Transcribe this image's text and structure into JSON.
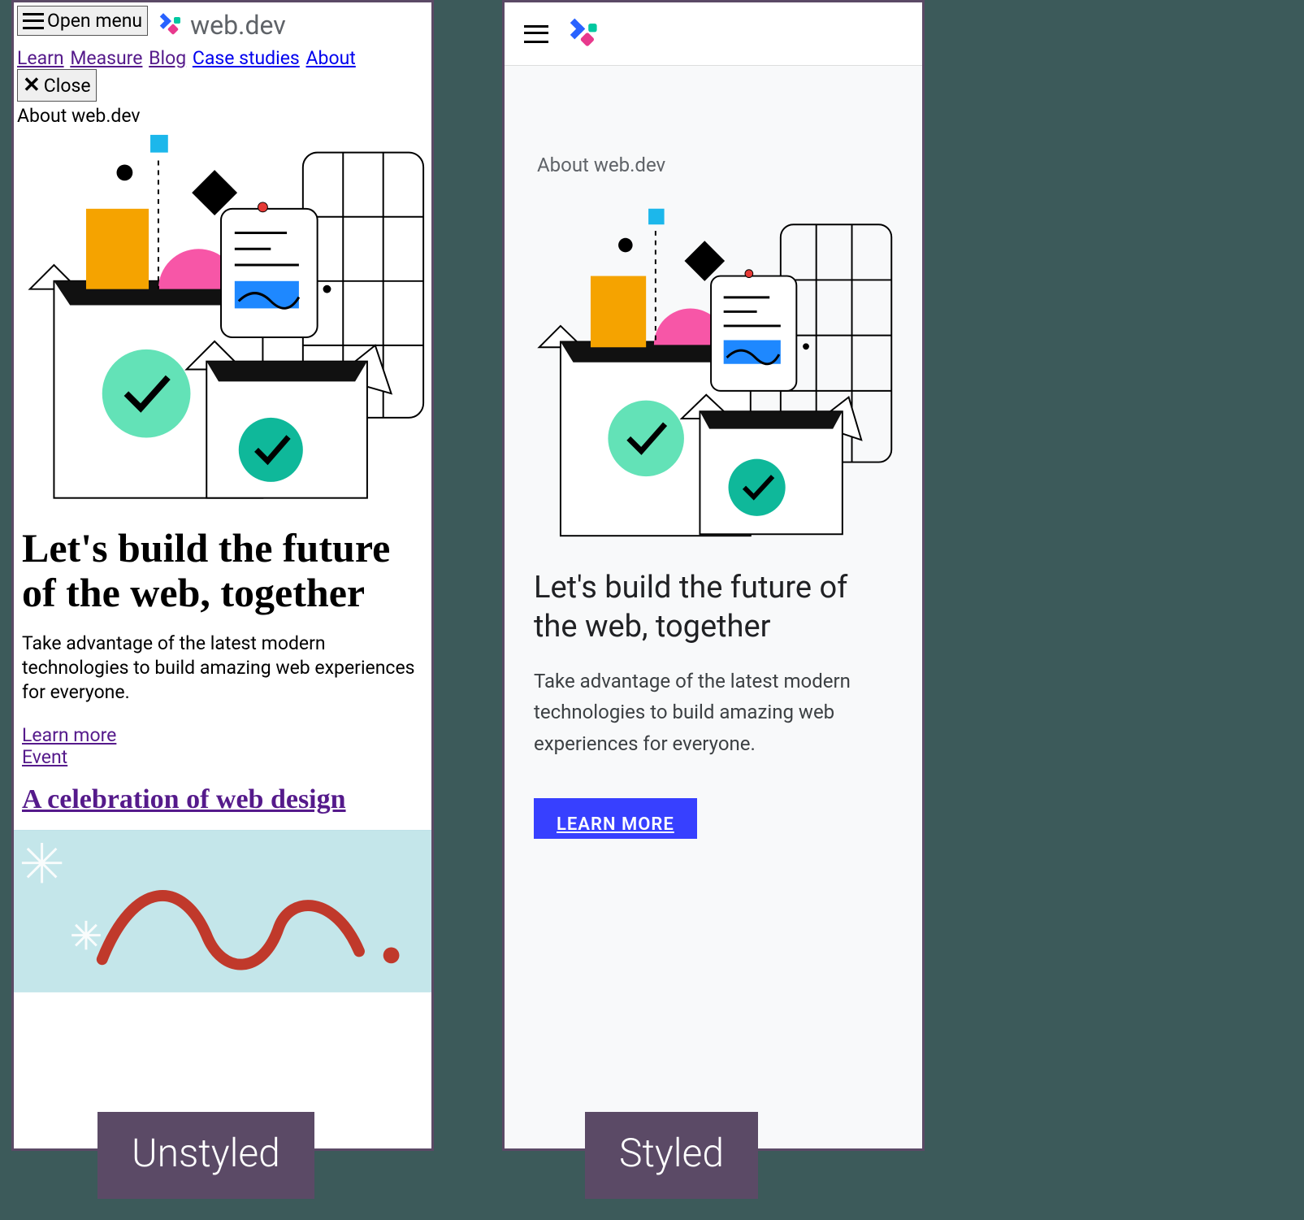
{
  "captions": {
    "unstyled": "Unstyled",
    "styled": "Styled"
  },
  "brand": {
    "name": "web.dev"
  },
  "unstyled": {
    "open_menu": "Open menu",
    "close": "Close",
    "nav": {
      "learn": "Learn",
      "measure": "Measure",
      "blog": "Blog",
      "case_studies": "Case studies",
      "about": "About"
    },
    "eyebrow": "About web.dev",
    "heading": "Let's build the future of the web, together",
    "sub": "Take advantage of the latest modern technologies to build amazing web experiences for everyone.",
    "learn_more": "Learn more",
    "event": "Event",
    "article_title": "A celebration of web design"
  },
  "styled": {
    "eyebrow": "About web.dev",
    "heading": "Let's build the future of the web, together",
    "sub": "Take advantage of the latest modern technologies to build amazing web experiences for everyone.",
    "cta": "LEARN MORE"
  }
}
